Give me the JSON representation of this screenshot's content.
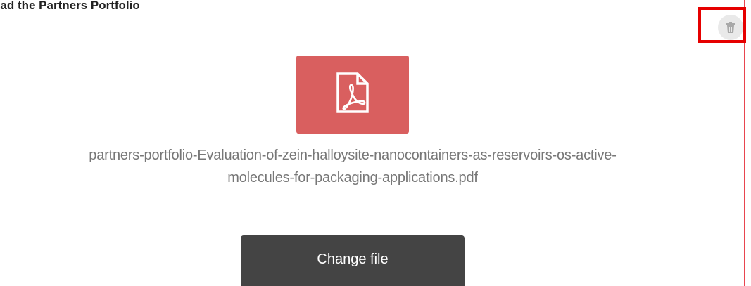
{
  "section": {
    "title": "oad the Partners Portfolio"
  },
  "file": {
    "icon": "pdf-file-icon",
    "name": "partners-portfolio-Evaluation-of-zein-halloysite-nanocontainers-as-reservoirs-os-active-molecules-for-packaging-applications.pdf",
    "name_line1": "partners-portfolio-Evaluation-of-zein-halloysite-nanocontainers-as-reservoirs-os-active-",
    "name_line2": "molecules-for-packaging-applications.pdf"
  },
  "actions": {
    "change_label": "Change file",
    "delete_icon": "trash-icon"
  },
  "colors": {
    "pdf_tile": "#d95f5f",
    "button": "#444444",
    "highlight": "#e60000",
    "border_accent": "#e8454f"
  }
}
